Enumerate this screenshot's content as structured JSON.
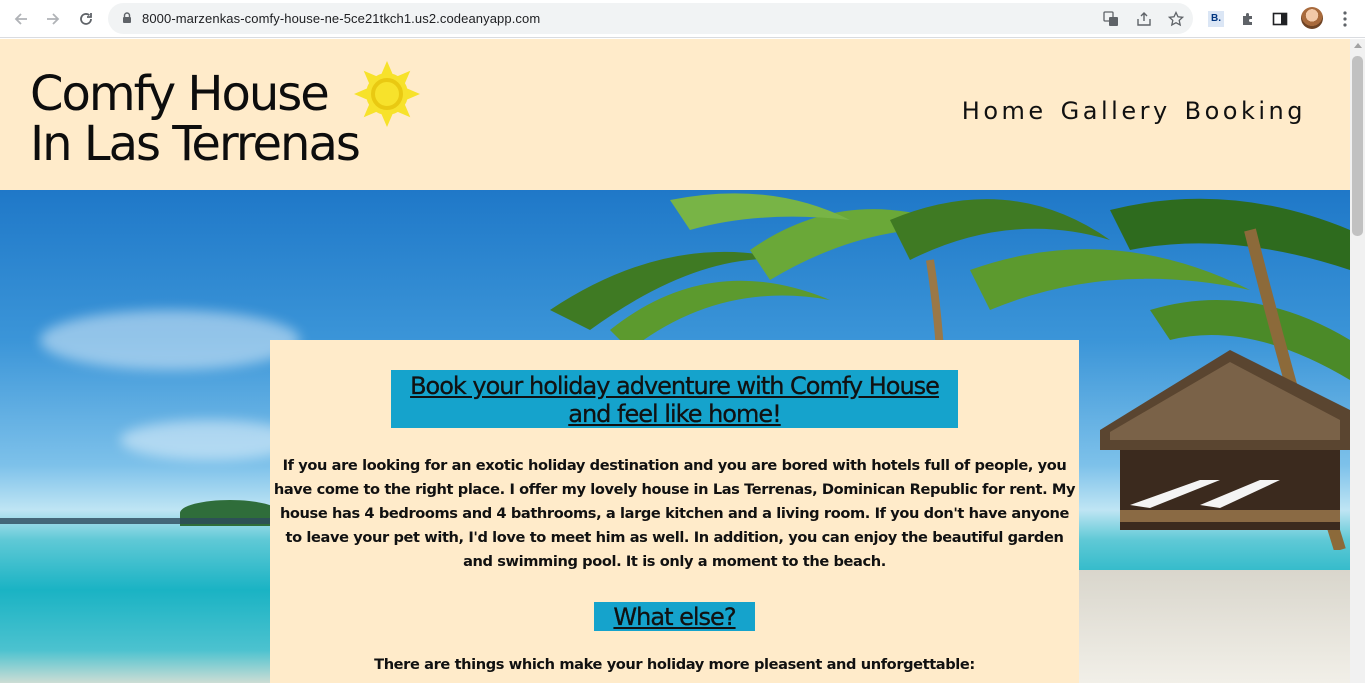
{
  "browser": {
    "url": "8000-marzenkas-comfy-house-ne-5ce21tkch1.us2.codeanyapp.com",
    "extension_label": "B."
  },
  "site": {
    "logo_line1": "Comfy House",
    "logo_line2": "In Las Terrenas",
    "nav": [
      "Home",
      "Gallery",
      "Booking"
    ],
    "accent_color": "#15a3cc",
    "background_color": "#ffebca",
    "sun_color": "#f7e22b"
  },
  "main": {
    "heading": "Book your holiday adventure with Comfy House and feel like home!",
    "intro": "If you are looking for an exotic holiday destination and you are bored with hotels full of people, you have come to the right place. I offer my lovely house in Las Terrenas, Dominican Republic for rent. My house has 4 bedrooms and 4 bathrooms, a large kitchen and a living room. If you don't have anyone to leave your pet with, I'd love to meet him as well. In addition, you can enjoy the beautiful garden and swimming pool. It is only a moment to the beach.",
    "subheading": "What else?",
    "lead": "There are things which make your holiday more pleasent and unforgettable:"
  }
}
